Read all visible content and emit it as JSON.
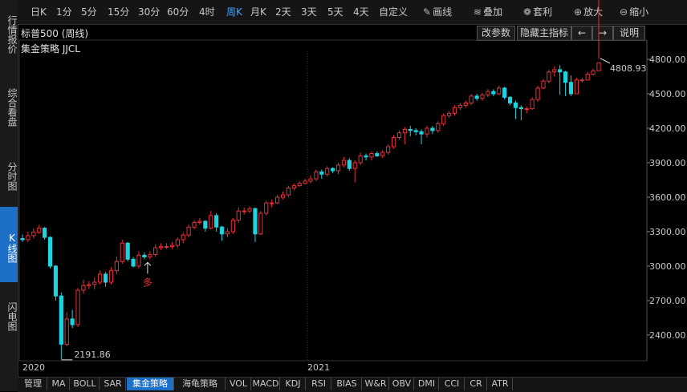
{
  "left_tabs": [
    {
      "label": "行情报价",
      "active": false
    },
    {
      "label": "综合看盘",
      "active": false
    },
    {
      "label": "分时图",
      "active": false
    },
    {
      "label": "K线图",
      "active": true
    },
    {
      "label": "闪电图",
      "active": false
    }
  ],
  "toolbar": {
    "periods": [
      "日K",
      "1分",
      "5分",
      "15分",
      "30分",
      "60分",
      "4时",
      "周K",
      "月K",
      "2天",
      "3天",
      "5天",
      "4天",
      "自定义"
    ],
    "active_period": "周K",
    "tools": [
      {
        "label": "画线",
        "icon": "pencil-icon"
      },
      {
        "label": "叠加",
        "icon": "stack-icon"
      },
      {
        "label": "套利",
        "icon": "moneybag-icon"
      },
      {
        "label": "放大",
        "icon": "zoom-in-icon"
      },
      {
        "label": "缩小",
        "icon": "zoom-out-icon"
      }
    ]
  },
  "chart_header": {
    "title": "标普500 (周线)",
    "strategy": "集金策略 JJCL",
    "buttons": [
      "改参数",
      "隐藏主指标",
      "←",
      "→",
      "说明"
    ]
  },
  "annotations": {
    "low_label": "2191.86",
    "high_label": "4808.93",
    "signal_label": "多"
  },
  "colors": {
    "up": "#e8303a",
    "down": "#1ed3e0",
    "background": "#000000",
    "active_tab": "#1d6fc7"
  },
  "chart_data": {
    "type": "candlestick",
    "yticks": [
      2400,
      2700,
      3000,
      3300,
      3600,
      3900,
      4200,
      4500,
      4800
    ],
    "ytick_labels": [
      "2400.00",
      "2700.00",
      "3000.00",
      "3300.00",
      "3600.00",
      "3900.00",
      "4200.00",
      "4500.00",
      "4800.00"
    ],
    "xticks": [
      {
        "label": "2020",
        "index": 0
      },
      {
        "label": "2021",
        "index": 52
      }
    ],
    "ylim": [
      2190,
      4870
    ],
    "low_index": 7,
    "high_index": 104,
    "signal_index": 22,
    "closes": [
      3230,
      3265,
      3295,
      3330,
      3250,
      3000,
      2740,
      2320,
      2540,
      2490,
      2790,
      2830,
      2840,
      2860,
      2930,
      2860,
      2960,
      3040,
      3200,
      3060,
      3000,
      3095,
      3080,
      3100,
      3160,
      3170,
      3170,
      3180,
      3230,
      3270,
      3340,
      3380,
      3390,
      3330,
      3440,
      3340,
      3280,
      3300,
      3400,
      3480,
      3480,
      3500,
      3280,
      3460,
      3550,
      3550,
      3600,
      3620,
      3680,
      3700,
      3720,
      3740,
      3760,
      3820,
      3800,
      3850,
      3830,
      3880,
      3920,
      3850,
      3900,
      3960,
      3950,
      3980,
      3960,
      3990,
      4040,
      4120,
      4160,
      4190,
      4180,
      4170,
      4150,
      4200,
      4180,
      4240,
      4310,
      4330,
      4380,
      4400,
      4420,
      4480,
      4460,
      4490,
      4520,
      4500,
      4550,
      4470,
      4420,
      4380,
      4370,
      4370,
      4450,
      4550,
      4610,
      4690,
      4710,
      4690,
      4600,
      4500,
      4620,
      4620,
      4670,
      4700,
      4770
    ],
    "opens": [
      3240,
      3230,
      3265,
      3295,
      3330,
      3250,
      3000,
      2740,
      2320,
      2540,
      2490,
      2790,
      2830,
      2840,
      2860,
      2930,
      2860,
      2960,
      3040,
      3200,
      3060,
      3000,
      3095,
      3080,
      3100,
      3160,
      3170,
      3170,
      3180,
      3230,
      3270,
      3340,
      3380,
      3390,
      3330,
      3440,
      3340,
      3280,
      3300,
      3400,
      3480,
      3480,
      3500,
      3280,
      3460,
      3550,
      3550,
      3600,
      3620,
      3680,
      3700,
      3720,
      3740,
      3760,
      3820,
      3800,
      3850,
      3830,
      3880,
      3920,
      3850,
      3900,
      3960,
      3950,
      3980,
      3960,
      3990,
      4040,
      4120,
      4160,
      4190,
      4180,
      4170,
      4150,
      4200,
      4180,
      4240,
      4310,
      4330,
      4380,
      4400,
      4420,
      4480,
      4460,
      4490,
      4520,
      4500,
      4550,
      4470,
      4420,
      4380,
      4370,
      4370,
      4450,
      4550,
      4610,
      4690,
      4710,
      4690,
      4600,
      4500,
      4620,
      4620,
      4670,
      4700
    ],
    "highs": [
      3275,
      3300,
      3330,
      3360,
      3340,
      3260,
      3010,
      2770,
      2600,
      2620,
      2810,
      2880,
      2870,
      2900,
      2960,
      2950,
      2990,
      3080,
      3230,
      3210,
      3080,
      3130,
      3120,
      3130,
      3190,
      3200,
      3200,
      3210,
      3250,
      3290,
      3360,
      3400,
      3420,
      3400,
      3480,
      3460,
      3350,
      3330,
      3420,
      3510,
      3510,
      3520,
      3510,
      3480,
      3570,
      3580,
      3620,
      3650,
      3700,
      3720,
      3740,
      3760,
      3790,
      3840,
      3840,
      3870,
      3860,
      3900,
      3950,
      3940,
      3920,
      3990,
      3980,
      4000,
      4000,
      4010,
      4060,
      4140,
      4180,
      4210,
      4220,
      4200,
      4190,
      4220,
      4220,
      4260,
      4330,
      4350,
      4400,
      4420,
      4440,
      4500,
      4500,
      4510,
      4540,
      4540,
      4570,
      4560,
      4480,
      4440,
      4400,
      4390,
      4470,
      4570,
      4630,
      4710,
      4740,
      4750,
      4700,
      4660,
      4640,
      4640,
      4690,
      4720,
      4808
    ],
    "lows": [
      3210,
      3210,
      3240,
      3280,
      3230,
      2980,
      2700,
      2191,
      2300,
      2460,
      2470,
      2760,
      2800,
      2800,
      2840,
      2820,
      2840,
      2930,
      3020,
      3040,
      2990,
      2980,
      3060,
      3060,
      3080,
      3140,
      3150,
      3150,
      3160,
      3200,
      3250,
      3320,
      3360,
      3300,
      3320,
      3300,
      3220,
      3250,
      3280,
      3380,
      3450,
      3460,
      3210,
      3270,
      3440,
      3510,
      3540,
      3580,
      3600,
      3660,
      3690,
      3710,
      3720,
      3740,
      3760,
      3780,
      3810,
      3800,
      3860,
      3830,
      3730,
      3880,
      3920,
      3920,
      3950,
      3940,
      3970,
      4020,
      4100,
      4060,
      4130,
      4140,
      4060,
      4120,
      4150,
      4160,
      4220,
      4290,
      4310,
      4360,
      4380,
      4400,
      4440,
      4440,
      4470,
      4480,
      4490,
      4450,
      4400,
      4280,
      4270,
      4330,
      4360,
      4430,
      4540,
      4590,
      4650,
      4490,
      4480,
      4480,
      4600,
      4600,
      4640,
      4660
    ]
  }
}
